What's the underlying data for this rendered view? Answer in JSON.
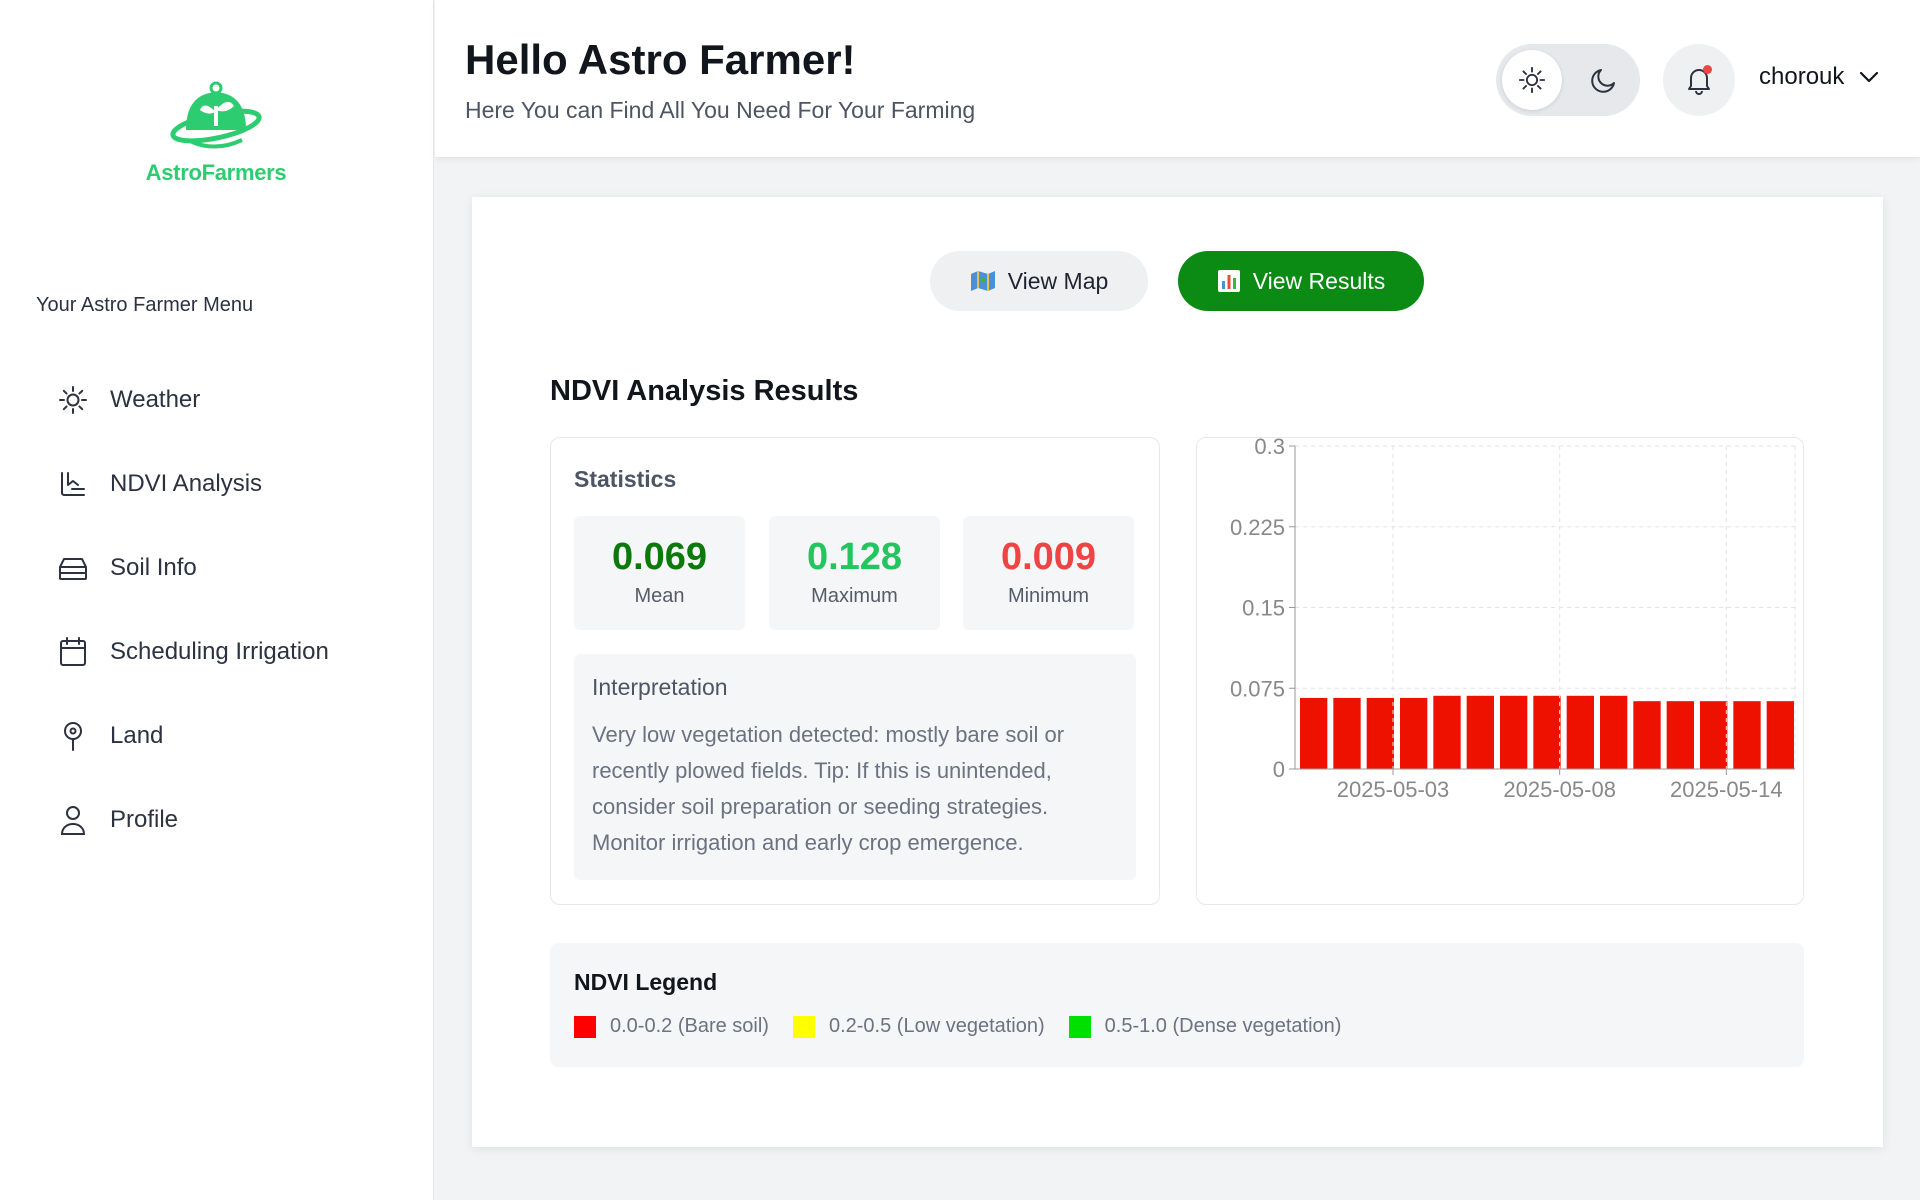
{
  "app": {
    "name": "AstroFarmers",
    "brand_color": "#2ecc71",
    "accent_color": "#0b8a14"
  },
  "sidebar": {
    "menu_title": "Your Astro Farmer Menu",
    "items": [
      {
        "label": "Weather",
        "icon": "sun-icon"
      },
      {
        "label": "NDVI Analysis",
        "icon": "download-tray-icon"
      },
      {
        "label": "Soil Info",
        "icon": "layers-icon"
      },
      {
        "label": "Scheduling Irrigation",
        "icon": "calendar-icon"
      },
      {
        "label": "Land",
        "icon": "map-pin-icon"
      },
      {
        "label": "Profile",
        "icon": "user-icon"
      }
    ]
  },
  "header": {
    "greeting": "Hello Astro Farmer!",
    "subtitle": "Here You can Find All You Need For Your Farming",
    "username": "chorouk",
    "theme": "light",
    "has_notification": true
  },
  "main": {
    "view_map_label": "View Map",
    "view_results_label": "View Results",
    "active_view": "View Results",
    "results_title": "NDVI Analysis Results",
    "statistics": {
      "title": "Statistics",
      "items": [
        {
          "value": "0.069",
          "label": "Mean",
          "color": "#0b7a0b"
        },
        {
          "value": "0.128",
          "label": "Maximum",
          "color": "#22c55e"
        },
        {
          "value": "0.009",
          "label": "Minimum",
          "color": "#ef4444"
        }
      ]
    },
    "interpretation": {
      "title": "Interpretation",
      "text": "Very low vegetation detected: mostly bare soil or recently plowed fields. Tip: If this is unintended, consider soil preparation or seeding strategies. Monitor irrigation and early crop emergence."
    },
    "legend": {
      "title": "NDVI Legend",
      "items": [
        {
          "label": "0.0-0.2 (Bare soil)",
          "color": "#ff0000"
        },
        {
          "label": "0.2-0.5 (Low vegetation)",
          "color": "#ffff00"
        },
        {
          "label": "0.5-1.0 (Dense vegetation)",
          "color": "#00e000"
        }
      ]
    }
  },
  "chart_data": {
    "type": "bar",
    "title": "",
    "xlabel": "",
    "ylabel": "",
    "ylim": [
      0,
      0.3
    ],
    "yticks": [
      "0",
      "0.075",
      "0.15",
      "0.225",
      "0.3"
    ],
    "xtick_labels": [
      "2025-05-03",
      "2025-05-08",
      "2025-05-14"
    ],
    "grid": true,
    "bar_color": "#ee1100",
    "values": [
      0.066,
      0.066,
      0.066,
      0.066,
      0.068,
      0.068,
      0.068,
      0.068,
      0.068,
      0.068,
      0.063,
      0.063,
      0.063,
      0.063,
      0.063
    ]
  }
}
